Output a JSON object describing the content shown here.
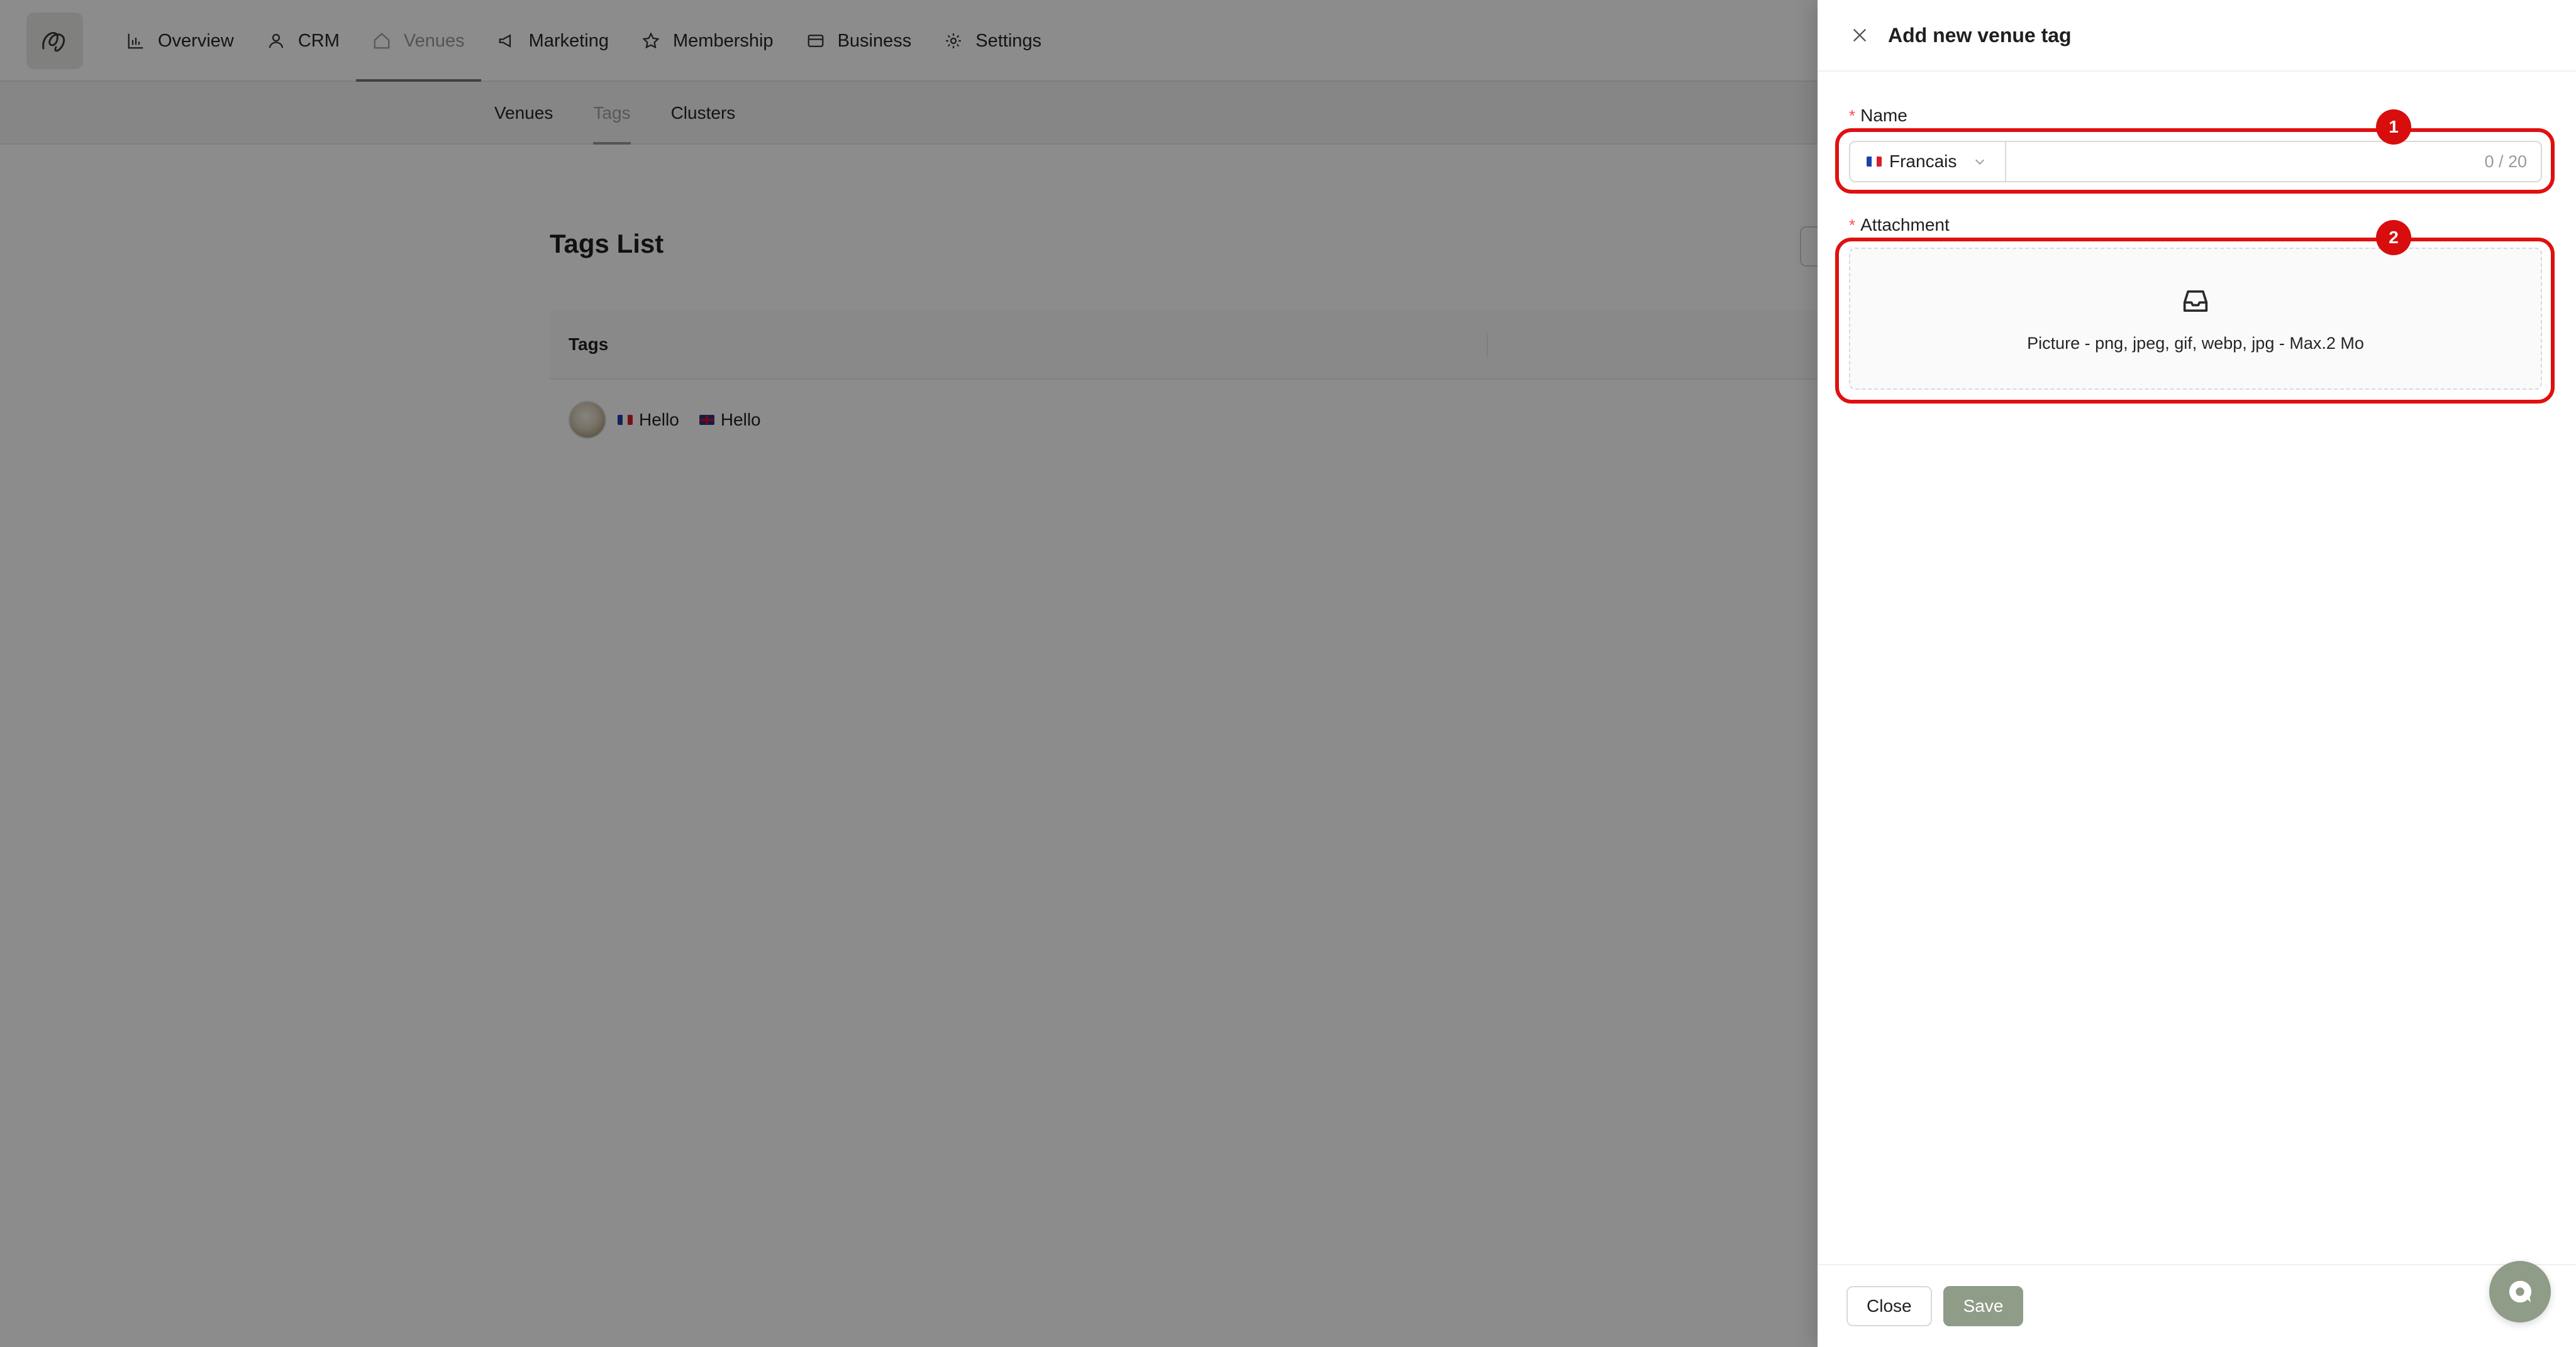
{
  "app": {
    "logo_icon": "brand-logo-icon"
  },
  "nav": {
    "items": [
      {
        "label": "Overview",
        "icon": "bar-chart-icon"
      },
      {
        "label": "CRM",
        "icon": "user-icon"
      },
      {
        "label": "Venues",
        "icon": "home-icon",
        "active": true
      },
      {
        "label": "Marketing",
        "icon": "megaphone-icon"
      },
      {
        "label": "Membership",
        "icon": "star-icon"
      },
      {
        "label": "Business",
        "icon": "wallet-icon"
      },
      {
        "label": "Settings",
        "icon": "gear-icon"
      }
    ]
  },
  "subnav": {
    "items": [
      {
        "label": "Venues"
      },
      {
        "label": "Tags",
        "active": true
      },
      {
        "label": "Clusters"
      }
    ]
  },
  "main": {
    "title": "Tags List",
    "table": {
      "column": "Tags",
      "rows": [
        {
          "tags": [
            {
              "flag": "fr",
              "text": "Hello"
            },
            {
              "flag": "gb",
              "text": "Hello"
            }
          ]
        }
      ]
    }
  },
  "drawer": {
    "title": "Add new venue tag",
    "name_label": "Name",
    "language": "Francais",
    "name_value": "",
    "name_count": "0 / 20",
    "attachment_label": "Attachment",
    "upload_hint": "Picture - png, jpeg, gif, webp, jpg - Max.2 Mo",
    "close_label": "Close",
    "save_label": "Save"
  },
  "annotations": {
    "badge_1": "1",
    "badge_2": "2"
  },
  "colors": {
    "accent": "#8f9c88",
    "annotation": "#e01010",
    "required": "#ff4d4f"
  }
}
